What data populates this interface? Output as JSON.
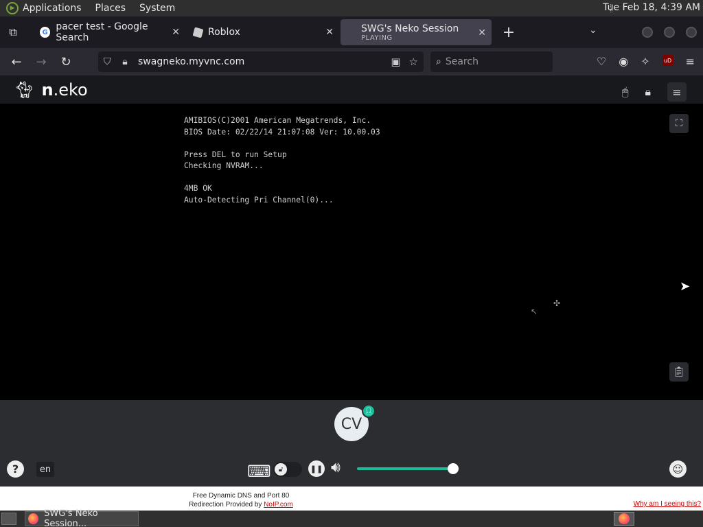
{
  "system_panel": {
    "menus": [
      "Applications",
      "Places",
      "System"
    ],
    "clock": "Tue Feb 18,  4:39 AM"
  },
  "tabs": [
    {
      "title": "pacer test - Google Search",
      "favicon": "G"
    },
    {
      "title": "Roblox",
      "favicon": "roblox"
    },
    {
      "title": "SWG's Neko Session",
      "subtitle": "PLAYING",
      "active": true
    }
  ],
  "url_bar": {
    "url": "swagneko.myvnc.com"
  },
  "search_bar": {
    "placeholder": "Search"
  },
  "ublock_badge": "uD",
  "neko": {
    "brand_bold": "n",
    "brand_rest": ".eko",
    "bios_text": "AMIBIOS(C)2001 American Megatrends, Inc.\nBIOS Date: 02/22/14 21:07:08 Ver: 10.00.03\n\nPress DEL to run Setup\nChecking NVRAM...\n\n4MB OK\nAuto-Detecting Pri Channel(0)...",
    "avatar_initials": "CV",
    "language": "en",
    "volume": 1.0,
    "accent_color": "#19bd9c"
  },
  "noip": {
    "line1": "Free Dynamic DNS and Port 80",
    "line2": "Redirection Provided by ",
    "link": "NoIP.com",
    "why": "Why am I seeing this?"
  },
  "taskbar": {
    "window_title": "SWG's Neko Session..."
  }
}
